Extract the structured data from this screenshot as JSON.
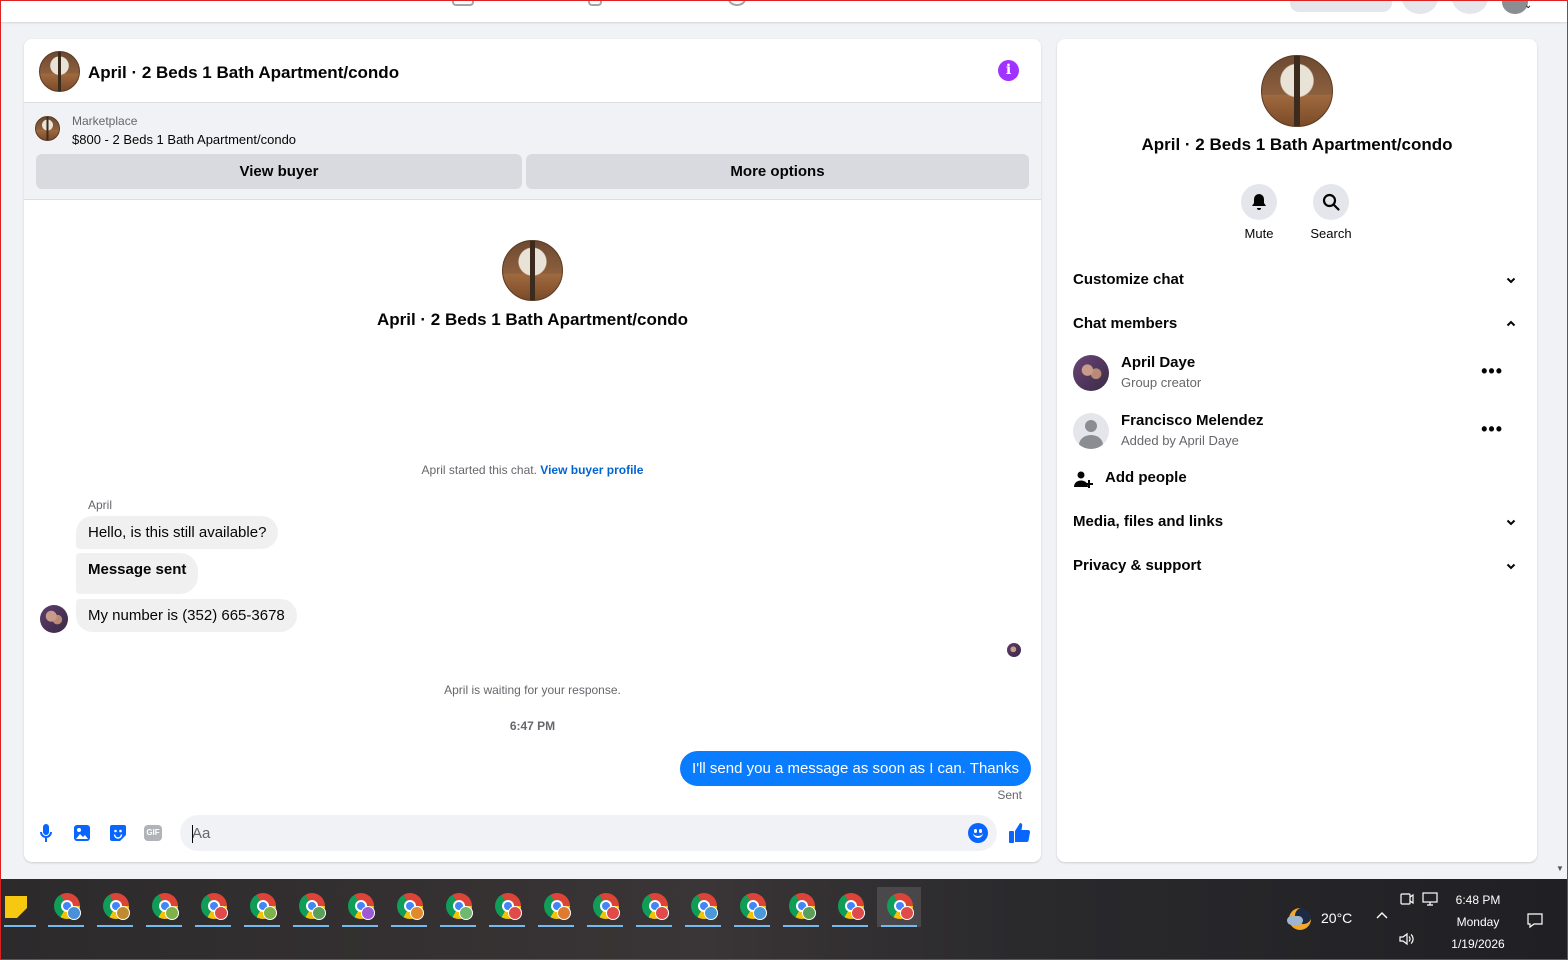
{
  "chat": {
    "title": "April · 2 Beds 1 Bath Apartment/condo",
    "marketplace": {
      "label": "Marketplace",
      "listing": "$800 - 2 Beds 1 Bath Apartment/condo",
      "view_buyer_label": "View buyer",
      "more_options_label": "More options"
    },
    "intro_title": "April · 2 Beds 1 Bath Apartment/condo",
    "system_message": "April started this chat.",
    "system_link": "View buyer profile",
    "sender_name": "April",
    "incoming_messages": [
      "Hello, is this still available?",
      "Message sent",
      "My number is (352) 665-3678"
    ],
    "waiting_text": "April is waiting for your response.",
    "timestamp": "6:47 PM",
    "outgoing_message": "I'll send you a message as soon as I can. Thanks",
    "sent_status": "Sent",
    "composer": {
      "placeholder": "Aa"
    },
    "gif_label": "GIF"
  },
  "details": {
    "title": "April · 2 Beds 1 Bath Apartment/condo",
    "actions": [
      {
        "label": "Mute",
        "icon": "bell-icon"
      },
      {
        "label": "Search",
        "icon": "search-icon"
      }
    ],
    "sections": {
      "customize_chat": "Customize chat",
      "chat_members": "Chat members",
      "media": "Media, files and links",
      "privacy": "Privacy & support"
    },
    "members": [
      {
        "name": "April Daye",
        "subtitle": "Group creator"
      },
      {
        "name": "Francisco Melendez",
        "subtitle": "Added by April Daye"
      }
    ],
    "more_glyph": "•••",
    "add_people_label": "Add people"
  },
  "taskbar": {
    "apps": [
      {
        "icon": "sticky-notes-icon"
      },
      {
        "icon": "chrome-icon",
        "badge": "#4a90d9"
      },
      {
        "icon": "chrome-icon",
        "badge": "#c28a2e"
      },
      {
        "icon": "chrome-icon",
        "badge": "#7fb24a"
      },
      {
        "icon": "chrome-icon",
        "badge": "#e04a4a"
      },
      {
        "icon": "chrome-icon",
        "badge": "#7fb24a"
      },
      {
        "icon": "chrome-icon",
        "badge": "#5aa05a"
      },
      {
        "icon": "chrome-icon",
        "badge": "#9b59d6"
      },
      {
        "icon": "chrome-icon",
        "badge": "#e08a2e"
      },
      {
        "icon": "chrome-icon",
        "badge": "#6fb86f"
      },
      {
        "icon": "chrome-icon",
        "badge": "#e04a4a"
      },
      {
        "icon": "chrome-icon",
        "badge": "#e07a2e"
      },
      {
        "icon": "chrome-icon",
        "badge": "#e04a4a"
      },
      {
        "icon": "chrome-icon",
        "badge": "#e04a4a"
      },
      {
        "icon": "chrome-icon",
        "badge": "#4a9ad9"
      },
      {
        "icon": "chrome-icon",
        "badge": "#4a9ad9"
      },
      {
        "icon": "chrome-icon",
        "badge": "#5aa05a"
      },
      {
        "icon": "chrome-icon",
        "badge": "#e04a4a"
      },
      {
        "icon": "chrome-icon",
        "badge": "#e04a4a"
      }
    ],
    "weather_temp": "20°C",
    "time": "6:48 PM",
    "day": "Monday",
    "date": "1/19/2026"
  },
  "colors": {
    "accent": "#0866ff",
    "outgoing_bubble": "#0a7cff",
    "info_purple": "#a033ff"
  }
}
